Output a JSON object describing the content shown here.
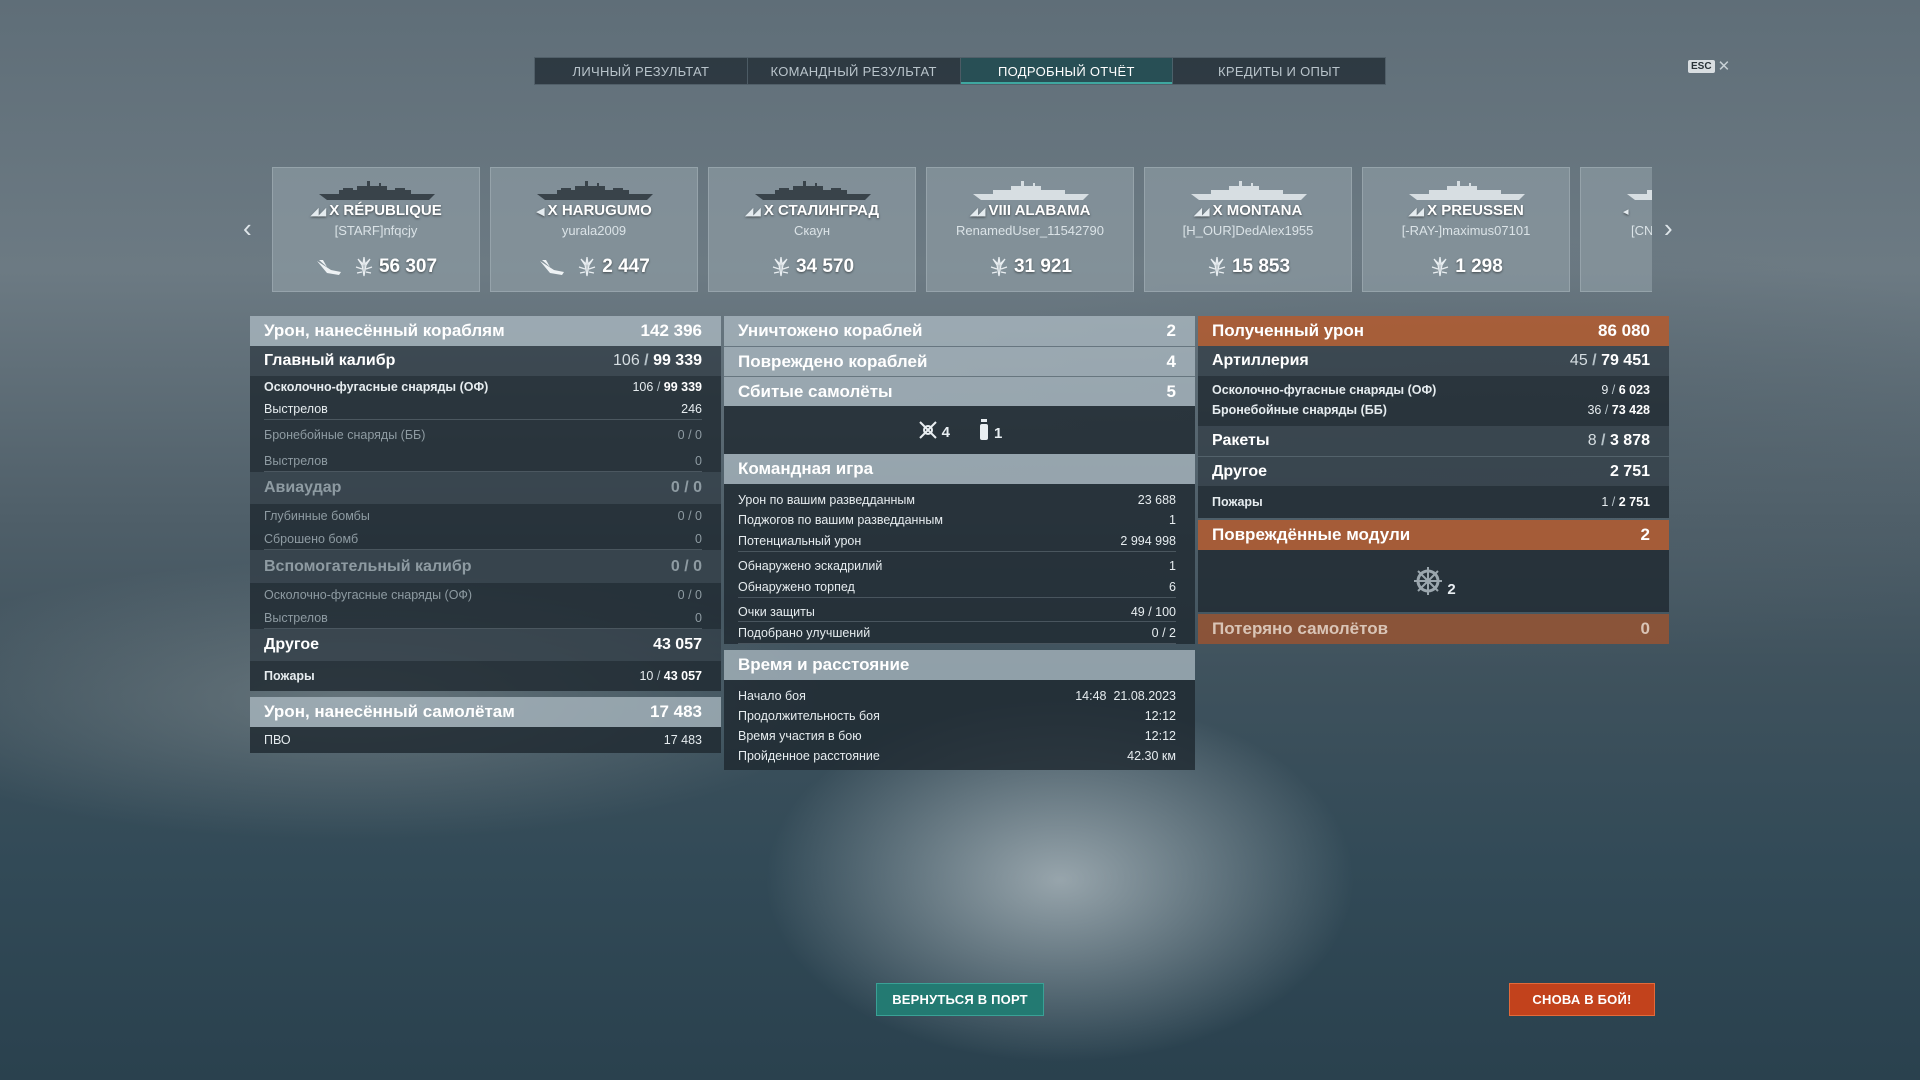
{
  "tabs": [
    {
      "label": "ЛИЧНЫЙ РЕЗУЛЬТАТ",
      "active": false
    },
    {
      "label": "КОМАНДНЫЙ РЕЗУЛЬТАТ",
      "active": false
    },
    {
      "label": "ПОДРОБНЫЙ ОТЧЁТ",
      "active": true
    },
    {
      "label": "КРЕДИТЫ И ОПЫТ",
      "active": false
    }
  ],
  "esc": {
    "key": "ESC",
    "close": "✕"
  },
  "carousel": {
    "prev": "‹",
    "next": "›",
    "ships": [
      {
        "tier_class": "◢◢",
        "name": "X RÉPUBLIQUE",
        "player": "[STARF]nfqcjy",
        "plane_damage": true,
        "damage": "56 307"
      },
      {
        "tier_class": "◀",
        "name": "X HARUGUMO",
        "player": "yurala2009",
        "plane_damage": true,
        "damage": "2 447"
      },
      {
        "tier_class": "◢◢",
        "name": "X СТАЛИНГРАД",
        "player": "Скаун",
        "plane_damage": false,
        "damage": "34 570"
      },
      {
        "tier_class": "◢◢",
        "name": "VIII ALABAMA",
        "player": "RenamedUser_11542790",
        "plane_damage": false,
        "damage": "31 921"
      },
      {
        "tier_class": "◢◢",
        "name": "X MONTANA",
        "player": "[H_OUR]DedAlex1955",
        "plane_damage": false,
        "damage": "15 853"
      },
      {
        "tier_class": "◢◢",
        "name": "X PREUSSEN",
        "player": "[-RAY-]maximus07101",
        "plane_damage": false,
        "damage": "1 298"
      },
      {
        "tier_class": "◂",
        "name": "",
        "player": "[CN",
        "plane_damage": false,
        "damage": ""
      }
    ]
  },
  "left": {
    "ship_damage": {
      "label": "Урон, нанесённый кораблям",
      "value": "142 396"
    },
    "main_battery": {
      "label": "Главный калибр",
      "hits": "106",
      "value": "99 339"
    },
    "he": {
      "label": "Осколочно-фугасные снаряды (ОФ)",
      "hits": "106",
      "value": "99 339"
    },
    "he_shots": {
      "label": "Выстрелов",
      "value": "246"
    },
    "ap": {
      "label": "Бронебойные снаряды (ББ)",
      "hits": "0",
      "value": "0"
    },
    "ap_shots": {
      "label": "Выстрелов",
      "value": "0"
    },
    "airstrike": {
      "label": "Авиаудар",
      "hits": "0",
      "value": "0"
    },
    "depth_charges": {
      "label": "Глубинные бомбы",
      "hits": "0",
      "value": "0"
    },
    "bombs_dropped": {
      "label": "Сброшено бомб",
      "value": "0"
    },
    "secondary": {
      "label": "Вспомогательный калибр",
      "hits": "0",
      "value": "0"
    },
    "sec_he": {
      "label": "Осколочно-фугасные снаряды (ОФ)",
      "hits": "0",
      "value": "0"
    },
    "sec_shots": {
      "label": "Выстрелов",
      "value": "0"
    },
    "other": {
      "label": "Другое",
      "value": "43 057"
    },
    "fires": {
      "label": "Пожары",
      "hits": "10",
      "value": "43 057"
    },
    "plane_damage": {
      "label": "Урон, нанесённый самолётам",
      "value": "17 483"
    },
    "aa": {
      "label": "ПВО",
      "value": "17 483"
    }
  },
  "middle": {
    "destroyed": {
      "label": "Уничтожено кораблей",
      "value": "2"
    },
    "damaged": {
      "label": "Повреждено кораблей",
      "value": "4"
    },
    "planes_down": {
      "label": "Сбитые самолёты",
      "value": "5"
    },
    "planes_icons": {
      "fighters": "4",
      "bombers": "1"
    },
    "team": {
      "label": "Командная игра"
    },
    "spot_damage": {
      "label": "Урон по вашим разведданным",
      "value": "23 688"
    },
    "spot_fires": {
      "label": "Поджогов по вашим разведданным",
      "value": "1"
    },
    "potential": {
      "label": "Потенциальный урон",
      "value": "2 994 998"
    },
    "squadrons": {
      "label": "Обнаружено эскадрилий",
      "value": "1"
    },
    "torpedoes": {
      "label": "Обнаружено торпед",
      "value": "6"
    },
    "defense": {
      "label": "Очки защиты",
      "a": "49",
      "b": "100"
    },
    "upgrades": {
      "label": "Подобрано улучшений",
      "a": "0",
      "b": "2"
    },
    "time": {
      "label": "Время и расстояние"
    },
    "start": {
      "label": "Начало боя",
      "time": "14:48",
      "date": "21.08.2023"
    },
    "duration": {
      "label": "Продолжительность боя",
      "value": "12:12"
    },
    "participation": {
      "label": "Время участия в бою",
      "value": "12:12"
    },
    "distance": {
      "label": "Пройденное расстояние",
      "value": "42.30 км"
    }
  },
  "right": {
    "received": {
      "label": "Полученный урон",
      "value": "86 080"
    },
    "artillery": {
      "label": "Артиллерия",
      "hits": "45",
      "value": "79 451"
    },
    "he": {
      "label": "Осколочно-фугасные снаряды (ОФ)",
      "hits": "9",
      "value": "6 023"
    },
    "ap": {
      "label": "Бронебойные снаряды (ББ)",
      "hits": "36",
      "value": "73 428"
    },
    "rockets": {
      "label": "Ракеты",
      "hits": "8",
      "value": "3 878"
    },
    "other": {
      "label": "Другое",
      "value": "2 751"
    },
    "fires": {
      "label": "Пожары",
      "hits": "1",
      "value": "2 751"
    },
    "modules": {
      "label": "Повреждённые модули",
      "value": "2"
    },
    "module_icon_count": "2",
    "planes_lost": {
      "label": "Потеряно самолётов",
      "value": "0"
    }
  },
  "buttons": {
    "port": "ВЕРНУТЬСЯ В ПОРТ",
    "battle": "СНОВА В БОЙ!"
  },
  "colors": {
    "accent_teal": "#237a72",
    "accent_orange": "#c2421c",
    "received_header": "#ac5c34"
  }
}
